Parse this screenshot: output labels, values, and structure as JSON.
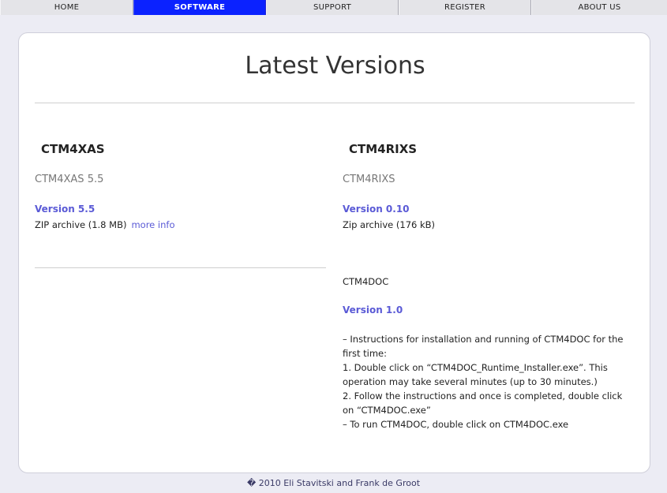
{
  "nav": {
    "items": [
      {
        "label": "HOME",
        "active": false
      },
      {
        "label": "SOFTWARE",
        "active": true
      },
      {
        "label": "SUPPORT",
        "active": false
      },
      {
        "label": "REGISTER",
        "active": false
      },
      {
        "label": "ABOUT US",
        "active": false
      }
    ],
    "active_color": "#0b22ff"
  },
  "main": {
    "title": "Latest Versions",
    "left": {
      "heading": "CTM4XAS",
      "name": "CTM4XAS 5.5",
      "version": "Version 5.5",
      "archive": "ZIP archive (1.8 MB)",
      "more_info": "more info"
    },
    "right": {
      "heading": "CTM4RIXS",
      "name": "CTM4RIXS",
      "version": "Version 0.10",
      "archive": "Zip archive (176 kB)"
    },
    "doc": {
      "name": "CTM4DOC",
      "version": "Version 1.0",
      "lines": [
        "– Instructions for installation and running of CTM4DOC for the first time:",
        "1. Double click on “CTM4DOC_Runtime_Installer.exe”. This operation may take several minutes (up to 30 minutes.)",
        "2. Follow the instructions and once is completed, double click on “CTM4DOC.exe”",
        "– To run CTM4DOC, double click on CTM4DOC.exe"
      ]
    }
  },
  "footer": {
    "text": "� 2010 Eli Stavitski and Frank de Groot"
  },
  "colors": {
    "link": "#5a5ad6",
    "background": "#ececf4"
  }
}
